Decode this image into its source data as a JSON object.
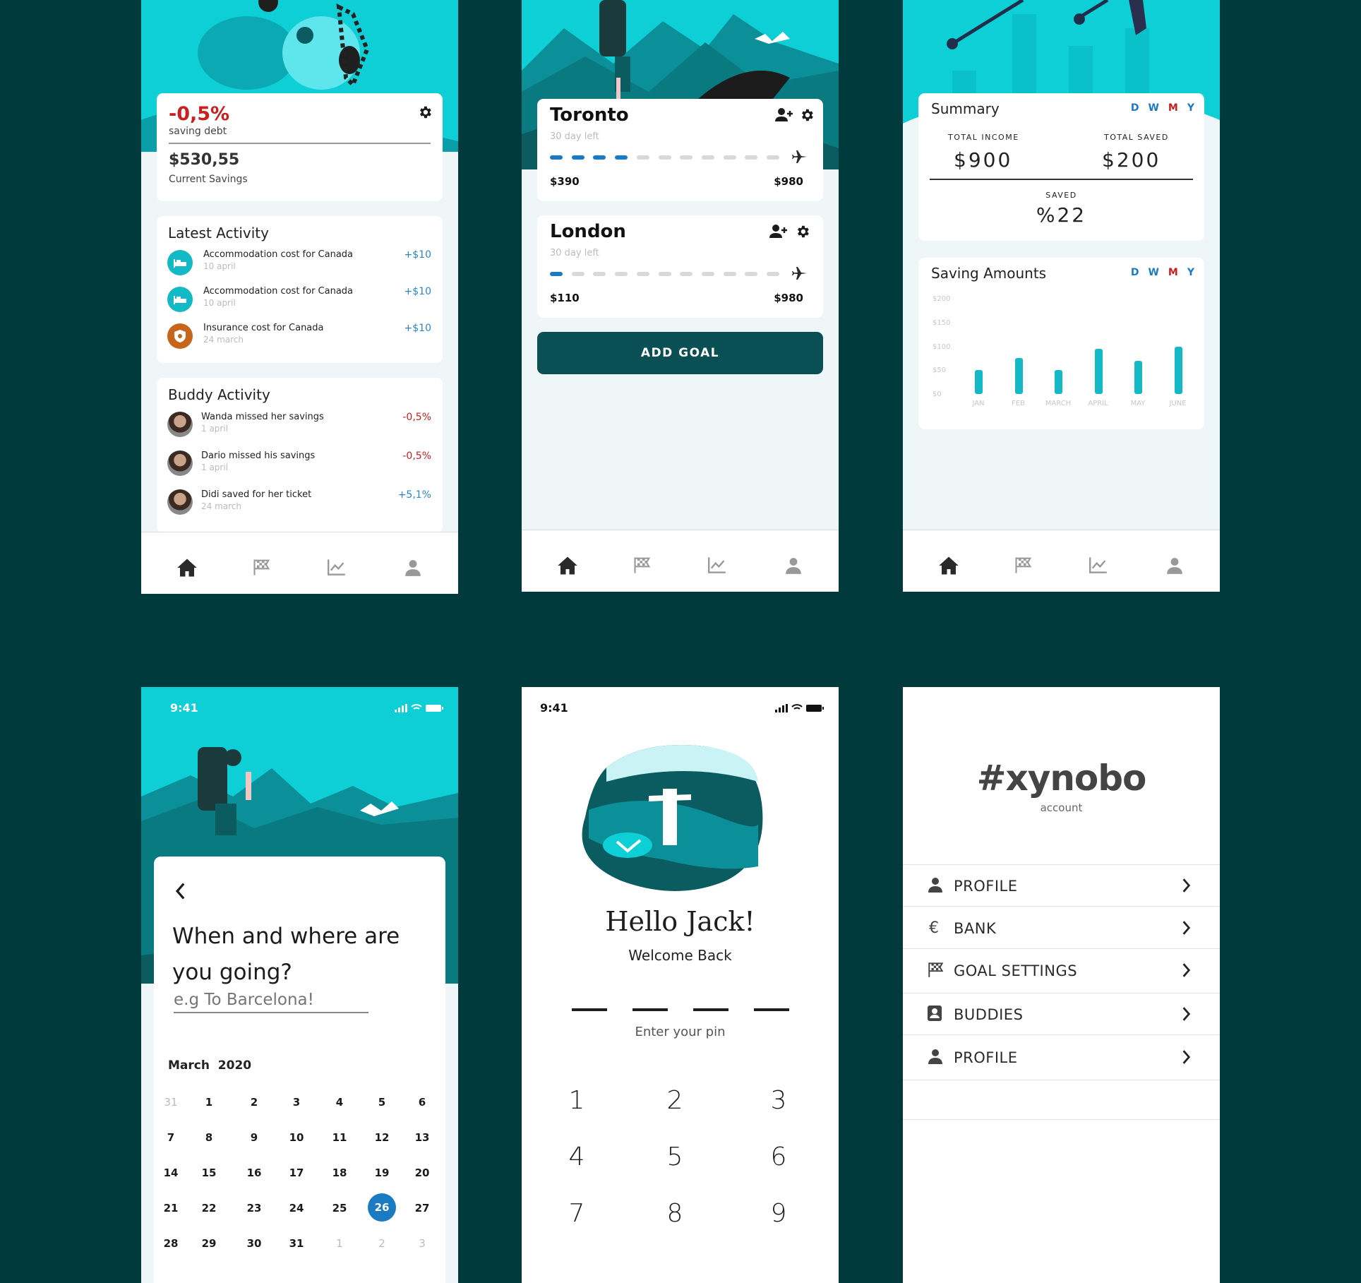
{
  "colors": {
    "bg": "#003a3c",
    "teal": "#0fcfd6",
    "dark_teal": "#0a5c60",
    "accent_blue": "#1a7bc3",
    "red": "#c7201f"
  },
  "screen1": {
    "savings_pct": "-0,5%",
    "saving_debt_label": "saving debt",
    "current_amount": "$530,55",
    "current_label": "Current Savings",
    "latest_title": "Latest Activity",
    "latest": [
      {
        "text": "Accommodation cost for Canada",
        "date": "10 april",
        "amount": "+$10",
        "icon": "bed-icon"
      },
      {
        "text": "Accommodation cost for Canada",
        "date": "10 april",
        "amount": "+$10",
        "icon": "bed-icon"
      },
      {
        "text": "Insurance cost for Canada",
        "date": "24 march",
        "amount": "+$10",
        "icon": "shield-icon"
      }
    ],
    "buddy_title": "Buddy Activity",
    "buddy": [
      {
        "text": "Wanda missed her savings",
        "date": "1 april",
        "amount": "-0,5%"
      },
      {
        "text": "Dario missed his savings",
        "date": "1 april",
        "amount": "-0,5%"
      },
      {
        "text": "Didi saved for her ticket",
        "date": "24 march",
        "amount": "+5,1%"
      }
    ]
  },
  "screen2": {
    "goals": [
      {
        "city": "Toronto",
        "days_left": "30 day left",
        "current": "$390",
        "target": "$980",
        "progress_segments": 4,
        "total_segments": 11
      },
      {
        "city": "London",
        "days_left": "30 day left",
        "current": "$110",
        "target": "$980",
        "progress_segments": 1,
        "total_segments": 11
      }
    ],
    "add_goal_label": "ADD GOAL"
  },
  "screen3": {
    "summary_title": "Summary",
    "periods": [
      "D",
      "W",
      "M",
      "Y"
    ],
    "total_income_label": "TOTAL INCOME",
    "total_income": "$900",
    "total_saved_label": "TOTAL SAVED",
    "total_saved": "$200",
    "saved_label": "SAVED",
    "saved_value": "%22",
    "saving_title": "Saving Amounts"
  },
  "chart_data": {
    "type": "bar",
    "title": "Saving Amounts",
    "categories": [
      "JAN",
      "FEB",
      "MARCH",
      "APRIL",
      "MAY",
      "JUNE"
    ],
    "values": [
      50,
      75,
      50,
      95,
      70,
      100
    ],
    "yticks": [
      "$200",
      "$150",
      "$100",
      "$50",
      "$0"
    ],
    "ylim": [
      0,
      200
    ]
  },
  "screen4": {
    "time": "9:41",
    "question": "When and where are you going?",
    "placeholder": "e.g To Barcelona!",
    "month": "March",
    "year": "2020",
    "weeks": [
      [
        "31",
        "1",
        "2",
        "3",
        "4",
        "5",
        "6"
      ],
      [
        "7",
        "8",
        "9",
        "10",
        "11",
        "12",
        "13"
      ],
      [
        "14",
        "15",
        "16",
        "17",
        "18",
        "19",
        "20"
      ],
      [
        "21",
        "22",
        "23",
        "24",
        "25",
        "26",
        "27"
      ],
      [
        "28",
        "29",
        "30",
        "31",
        "1",
        "2",
        "3"
      ]
    ],
    "selected_day": "26"
  },
  "screen5": {
    "time": "9:41",
    "greeting": "Hello Jack!",
    "welcome": "Welcome Back",
    "pin_hint": "Enter your pin",
    "keys": [
      "1",
      "2",
      "3",
      "4",
      "5",
      "6",
      "7",
      "8",
      "9"
    ]
  },
  "screen6": {
    "logo": "#xynobo",
    "account_label": "account",
    "menu": [
      {
        "label": "PROFILE",
        "icon": "user-icon"
      },
      {
        "label": "BANK",
        "icon": "euro-icon"
      },
      {
        "label": "GOAL SETTINGS",
        "icon": "flag-icon"
      },
      {
        "label": "BUDDIES",
        "icon": "contact-icon"
      },
      {
        "label": "PROFILE",
        "icon": "user-icon"
      }
    ]
  },
  "nav": [
    "home-icon",
    "flag-icon",
    "chart-icon",
    "user-icon"
  ]
}
